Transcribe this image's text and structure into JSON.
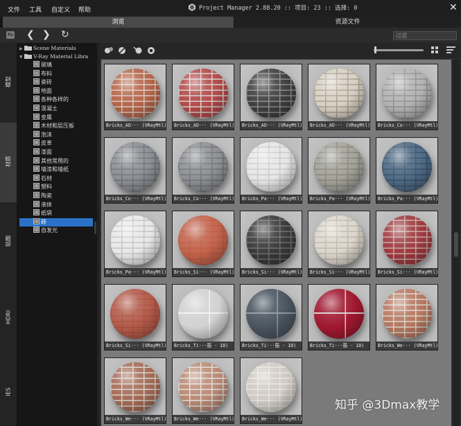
{
  "menu": {
    "file": "文件",
    "tools": "工具",
    "customize": "自定义",
    "help": "帮助"
  },
  "window": {
    "title": "Project Manager 2.88.20 :: 项目: 23 :: 选择: 0",
    "close_glyph": "✕"
  },
  "tabs": {
    "browse": "浏览",
    "asset_files": "资源文件"
  },
  "toolbar": {
    "back_glyph": "❮",
    "forward_glyph": "❯",
    "refresh_glyph": "↻",
    "filter_placeholder": "过滤",
    "ps_badge": "Ps"
  },
  "side_tabs": [
    "模型",
    "材质",
    "贴图",
    "HDRI",
    "IES"
  ],
  "tree": {
    "scene_materials": "Scene Materials",
    "vray_library": "V-Ray Material Libra",
    "items": [
      "玻璃",
      "布料",
      "瓷砖",
      "地面",
      "各种各样的",
      "混凝土",
      "金属",
      "木材和层压板",
      "泡沫",
      "皮革",
      "漆面",
      "其他常用的",
      "墙漆和墙纸",
      "石材",
      "塑料",
      "陶瓷",
      "液体",
      "纸袋",
      "砖",
      "自发光"
    ],
    "selected_index": 18
  },
  "materials": [
    {
      "caption": "Bricks_AO··· (VRayMtl)",
      "base": "#b5654a",
      "mortar": "#d9c9bc"
    },
    {
      "caption": "Bricks_AO··· (VRayMtl)",
      "base": "#b24a4a",
      "mortar": "#d6cfc8"
    },
    {
      "caption": "Bricks_AO··· (VRayMtl)",
      "base": "#3f3f3f",
      "mortar": "#8a8a8a"
    },
    {
      "caption": "Bricks_AO··· (VRayMtl)",
      "base": "#d8d0c2",
      "mortar": "#a89f92"
    },
    {
      "caption": "Bricks_Co··· (VRayMtl)",
      "base": "#b3b3b3",
      "mortar": "#8f8f8f"
    },
    {
      "caption": "Bricks_Co··· (VRayMtl)",
      "base": "#8c8f94",
      "mortar": "#6e7176"
    },
    {
      "caption": "Bricks_Co··· (VRayMtl)",
      "base": "#8e9094",
      "mortar": "#707276"
    },
    {
      "caption": "Bricks_Pa··· (VRayMtl)",
      "base": "#e6e6e6",
      "mortar": "#c8c8c8"
    },
    {
      "caption": "Bricks_Pa··· (VRayMtl)",
      "base": "#a3a39a",
      "mortar": "#85857c"
    },
    {
      "caption": "Bricks_Pa··· (VRayMtl)",
      "base": "#4e6a85",
      "mortar": "#3a5068"
    },
    {
      "caption": "Bricks_Pa··· (VRayMtl)",
      "base": "#e8e8e8",
      "mortar": "#c2c2c2"
    },
    {
      "caption": "Bricks_Si··· (VRayMtl)",
      "base": "#c4634c",
      "mortar": "#b85a44"
    },
    {
      "caption": "Bricks_Si··· (VRayMtl)",
      "base": "#3a3a3a",
      "mortar": "#6d6d6d"
    },
    {
      "caption": "Bricks_Si··· (VRayMtl)",
      "base": "#dcd6cc",
      "mortar": "#bdb6ab"
    },
    {
      "caption": "Bricks_Si··· (VRayMtl)",
      "base": "#9e3a40",
      "mortar": "#c7a9a0"
    },
    {
      "caption": "Bricks_Si··· (VRayMtl)",
      "base": "#b35b4a",
      "mortar": "#a84f40"
    },
    {
      "caption": "Bricks_Ti···筋 - 10)",
      "base": "#d2d2d2",
      "mortar": "#f2f2f2"
    },
    {
      "caption": "Bricks_Ti···筋 - 10)",
      "base": "#4a5560",
      "mortar": "#8d969e"
    },
    {
      "caption": "Bricks_Ti···筋 - 10)",
      "base": "#a01830",
      "mortar": "#d8d0d0"
    },
    {
      "caption": "Bricks_We··· (VRayMtl)",
      "base": "#b67860",
      "mortar": "#d9d3c9"
    },
    {
      "caption": "Bricks_We··· (VRayMtl)",
      "base": "#a56b58",
      "mortar": "#d6d0c6"
    },
    {
      "caption": "Bricks_We··· (VRayMtl)",
      "base": "#b98a76",
      "mortar": "#e2ddd5"
    },
    {
      "caption": "Bricks_We··· (VRayMtl)",
      "base": "#cfcac3",
      "mortar": "#e6e3dd"
    }
  ],
  "watermark": "知乎 @3Dmax教学"
}
